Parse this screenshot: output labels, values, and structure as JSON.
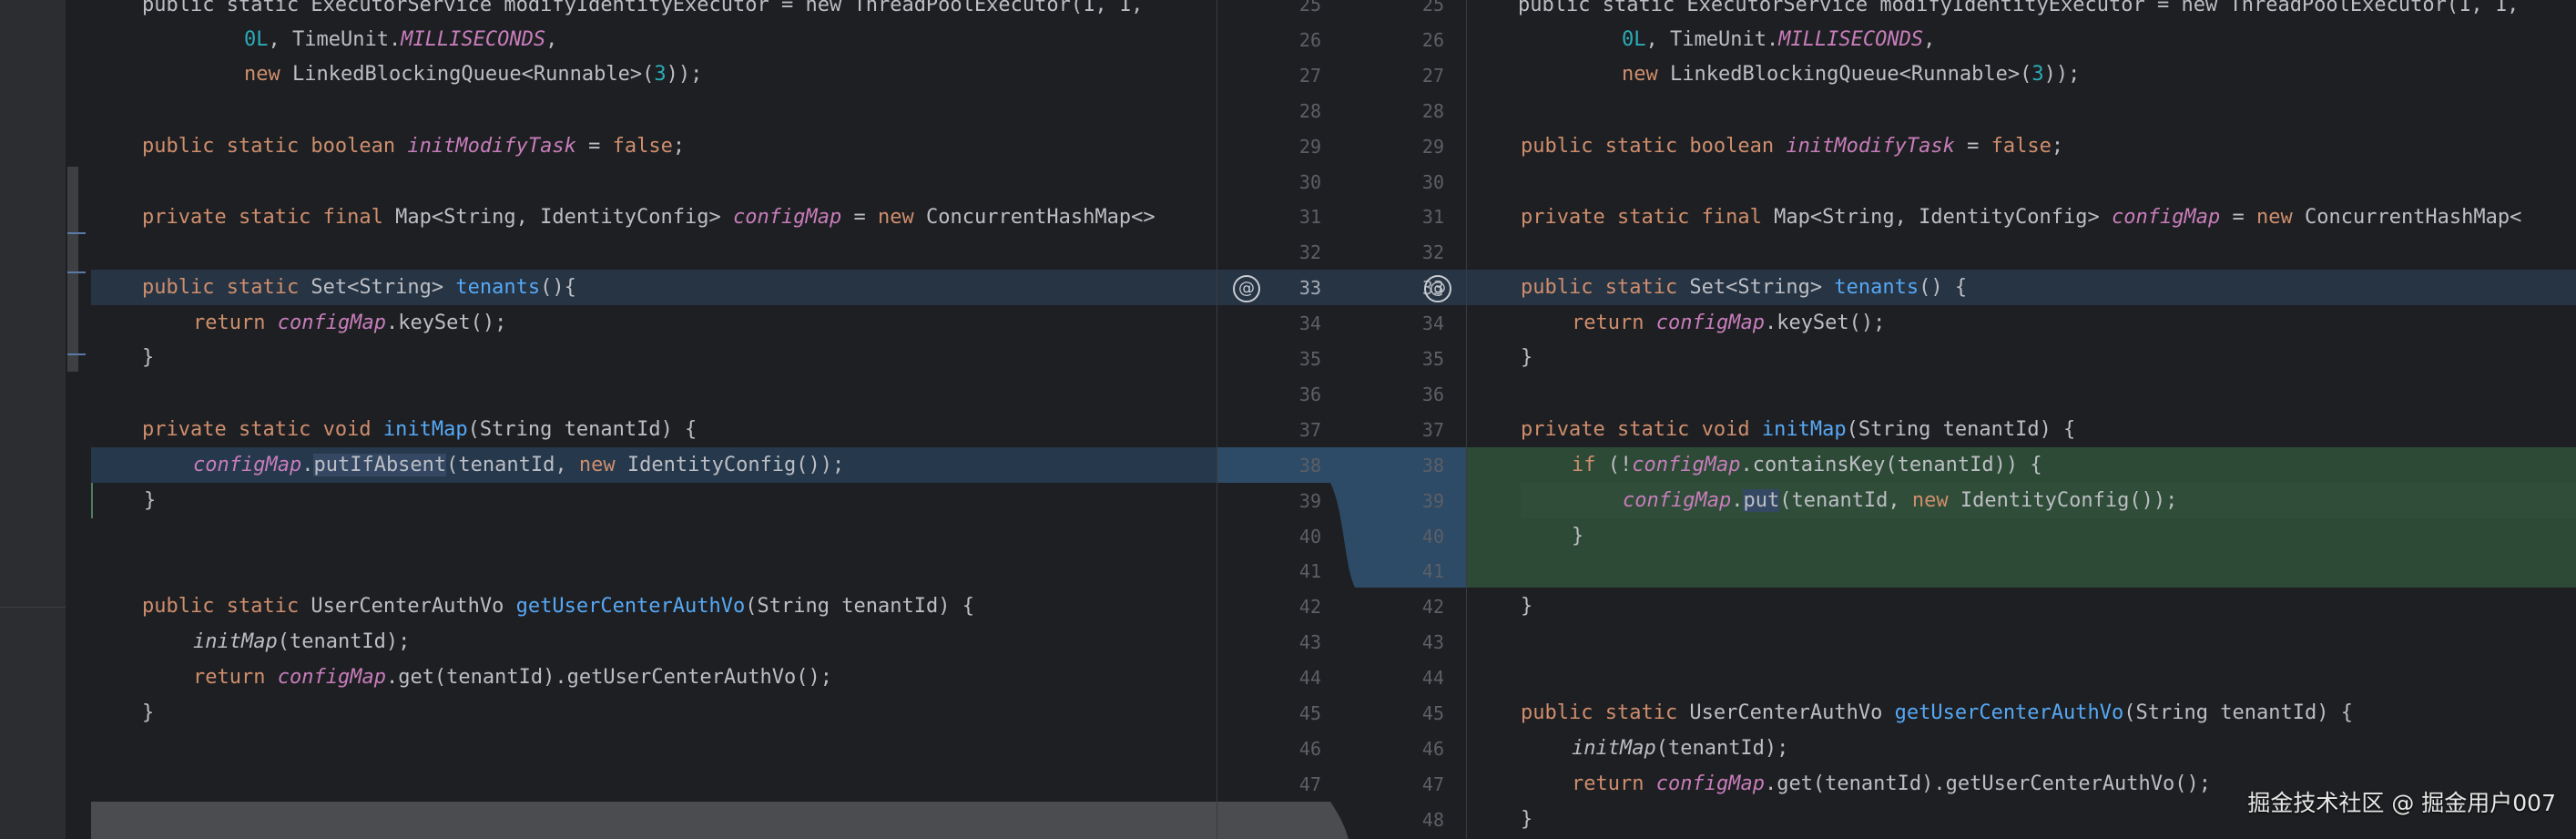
{
  "left": {
    "l25": "public static ExecutorService modifyIdentityExecutor = new ThreadPoolExecutor(1, 1,",
    "l26a": "0L",
    "l26b": ", TimeUnit.",
    "l26c": "MILLISECONDS",
    "l26d": ",",
    "l27a": "new",
    "l27b": " LinkedBlockingQueue<Runnable>(",
    "l27c": "3",
    "l27d": "));",
    "l29a": "public static boolean",
    "l29b": "initModifyTask",
    "l29c": " = ",
    "l29d": "false",
    "l29e": ";",
    "l31a": "private static final",
    "l31b": " Map<String, IdentityConfig> ",
    "l31c": "configMap",
    "l31d": " = ",
    "l31e": "new",
    "l31f": " ConcurrentHashMap<>",
    "l33a": "public static",
    "l33b": " Set<String> ",
    "l33c": "tenants",
    "l33d": "(){",
    "l34a": "return",
    "l34b": "configMap",
    "l34c": ".keySet();",
    "l35": "}",
    "l37a": "private static void",
    "l37b": "initMap",
    "l37c": "(String tenantId) {",
    "l38a": "configMap",
    "l38b": ".",
    "l38c": "putIfAbsent",
    "l38d": "(tenantId, ",
    "l38e": "new",
    "l38f": " IdentityConfig());",
    "l39": "}",
    "l42a": "public static",
    "l42b": " UserCenterAuthVo ",
    "l42c": "getUserCenterAuthVo",
    "l42d": "(String tenantId) {",
    "l43a": "initMap",
    "l43b": "(tenantId);",
    "l44a": "return",
    "l44b": "configMap",
    "l44c": ".get(tenantId).getUserCenterAuthVo();",
    "l45": "}"
  },
  "right": {
    "r25": "public static ExecutorService modifyIdentityExecutor = new ThreadPoolExecutor(1, 1,",
    "r26a": "0L",
    "r26b": ", TimeUnit.",
    "r26c": "MILLISECONDS",
    "r26d": ",",
    "r27a": "new",
    "r27b": " LinkedBlockingQueue<Runnable>(",
    "r27c": "3",
    "r27d": "));",
    "r29a": "public static boolean",
    "r29b": "initModifyTask",
    "r29c": " = ",
    "r29d": "false",
    "r29e": ";",
    "r31a": "private static final",
    "r31b": " Map<String, IdentityConfig> ",
    "r31c": "configMap",
    "r31d": " = ",
    "r31e": "new",
    "r31f": " ConcurrentHashMap<",
    "r33a": "public static",
    "r33b": " Set<String> ",
    "r33c": "tenants",
    "r33d": "() {",
    "r34a": "return",
    "r34b": "configMap",
    "r34c": ".keySet();",
    "r35": "}",
    "r37a": "private static void",
    "r37b": "initMap",
    "r37c": "(String tenantId) {",
    "r38a": "if",
    "r38b": " (!",
    "r38c": "configMap",
    "r38d": ".containsKey(tenantId)) {",
    "r39a": "configMap",
    "r39b": ".",
    "r39c": "put",
    "r39d": "(tenantId, ",
    "r39e": "new",
    "r39f": " IdentityConfig());",
    "r40": "}",
    "r42": "}",
    "r45a": "public static",
    "r45b": " UserCenterAuthVo ",
    "r45c": "getUserCenterAuthVo",
    "r45d": "(String tenantId) {",
    "r46a": "initMap",
    "r46b": "(tenantId);",
    "r47a": "return",
    "r47b": "configMap",
    "r47c": ".get(tenantId).getUserCenterAuthVo();",
    "r48": "}"
  },
  "line_numbers": {
    "left": [
      "25",
      "26",
      "27",
      "28",
      "29",
      "30",
      "31",
      "32",
      "33",
      "34",
      "35",
      "36",
      "37",
      "38",
      "39",
      "40",
      "41",
      "42",
      "43",
      "44",
      "45",
      "46",
      "47"
    ],
    "right": [
      "25",
      "26",
      "27",
      "28",
      "29",
      "30",
      "31",
      "32",
      "33",
      "34",
      "35",
      "36",
      "37",
      "38",
      "39",
      "40",
      "41",
      "42",
      "43",
      "44",
      "45",
      "46",
      "47",
      "48"
    ]
  },
  "icons": {
    "annotation": "@"
  },
  "watermark": "掘金技术社区 @ 掘金用户007",
  "colors": {
    "keyword": "#cf8e6d",
    "field": "#c77dbb",
    "method": "#56a8f5",
    "number": "#2aacb8",
    "diff_changed": "#263444",
    "diff_added": "#2c4a36"
  }
}
